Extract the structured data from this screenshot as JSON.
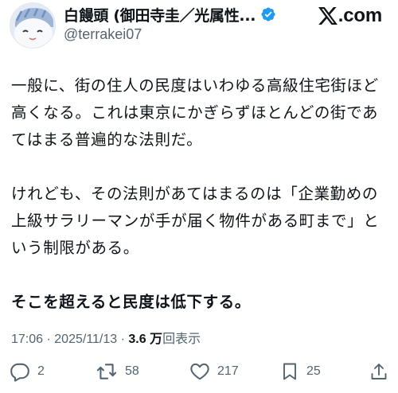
{
  "author": {
    "display_name": "白饅頭 (御田寺圭／光属性...",
    "handle": "@terrakei07",
    "verified_color": "#1d9bf0"
  },
  "brand": {
    "text": ".com",
    "icon": "x-logo-icon"
  },
  "tweet": {
    "paragraphs": [
      "一般に、街の住人の民度はいわゆる高級住宅街ほど高くなる。これは東京にかぎらずほとんどの街であてはまる普遍的な法則だ。",
      "けれども、その法則があてはまるのは「企業勤めの上級サラリーマンが手が届く物件がある町まで」という制限がある。",
      "そこを超えると民度は低下する。"
    ]
  },
  "meta": {
    "time": "17:06",
    "separator": "·",
    "date": "2025/11/13",
    "views_count": "3.6 万",
    "views_label": "回表示"
  },
  "actions": {
    "reply_count": "2",
    "retweet_count": "58",
    "like_count": "217",
    "bookmark_count": "25"
  },
  "colors": {
    "text": "#0f1419",
    "secondary": "#536471",
    "verified": "#1d9bf0"
  }
}
